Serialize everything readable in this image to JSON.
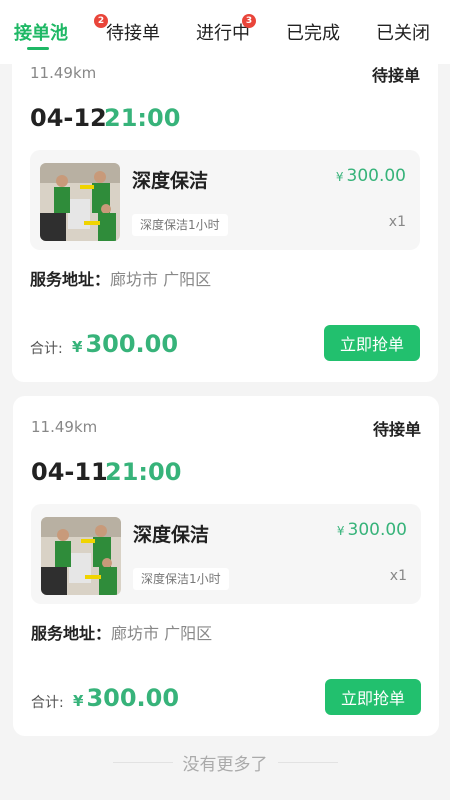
{
  "tabs": [
    {
      "label": "接单池",
      "badge": "2",
      "active": true
    },
    {
      "label": "待接单",
      "badge": ""
    },
    {
      "label": "进行中",
      "badge": "3"
    },
    {
      "label": "已完成",
      "badge": ""
    },
    {
      "label": "已关闭",
      "badge": ""
    }
  ],
  "orders": [
    {
      "distance": "11.49km",
      "status": "待接单",
      "date": "04-12",
      "time": "21:00",
      "service": {
        "name": "深度保洁",
        "tag": "深度保洁1小时",
        "currency": "¥",
        "price": "300.00",
        "qty": "x1"
      },
      "address_label": "服务地址：",
      "address": "廊坊市 广阳区",
      "total_label": "合计:",
      "total_currency": "¥",
      "total": "300.00",
      "button": "立即抢单"
    },
    {
      "distance": "11.49km",
      "status": "待接单",
      "date": "04-11",
      "time": "21:00",
      "service": {
        "name": "深度保洁",
        "tag": "深度保洁1小时",
        "currency": "¥",
        "price": "300.00",
        "qty": "x1"
      },
      "address_label": "服务地址：",
      "address": "廊坊市 广阳区",
      "total_label": "合计:",
      "total_currency": "¥",
      "total": "300.00",
      "button": "立即抢单"
    }
  ],
  "footer": {
    "end_text": "没有更多了"
  },
  "colors": {
    "accent": "#1fb865",
    "price": "#37b37a",
    "badge": "#e9453a"
  }
}
